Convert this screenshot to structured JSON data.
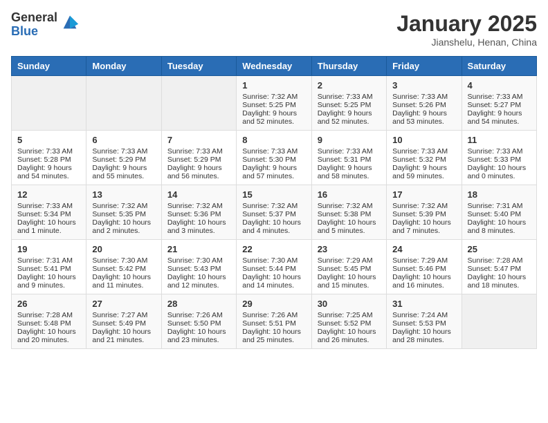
{
  "header": {
    "logo_general": "General",
    "logo_blue": "Blue",
    "month_title": "January 2025",
    "location": "Jianshelu, Henan, China"
  },
  "weekdays": [
    "Sunday",
    "Monday",
    "Tuesday",
    "Wednesday",
    "Thursday",
    "Friday",
    "Saturday"
  ],
  "weeks": [
    [
      {
        "day": "",
        "empty": true
      },
      {
        "day": "",
        "empty": true
      },
      {
        "day": "",
        "empty": true
      },
      {
        "day": "1",
        "sunrise": "Sunrise: 7:32 AM",
        "sunset": "Sunset: 5:25 PM",
        "daylight": "Daylight: 9 hours and 52 minutes."
      },
      {
        "day": "2",
        "sunrise": "Sunrise: 7:33 AM",
        "sunset": "Sunset: 5:25 PM",
        "daylight": "Daylight: 9 hours and 52 minutes."
      },
      {
        "day": "3",
        "sunrise": "Sunrise: 7:33 AM",
        "sunset": "Sunset: 5:26 PM",
        "daylight": "Daylight: 9 hours and 53 minutes."
      },
      {
        "day": "4",
        "sunrise": "Sunrise: 7:33 AM",
        "sunset": "Sunset: 5:27 PM",
        "daylight": "Daylight: 9 hours and 54 minutes."
      }
    ],
    [
      {
        "day": "5",
        "sunrise": "Sunrise: 7:33 AM",
        "sunset": "Sunset: 5:28 PM",
        "daylight": "Daylight: 9 hours and 54 minutes."
      },
      {
        "day": "6",
        "sunrise": "Sunrise: 7:33 AM",
        "sunset": "Sunset: 5:29 PM",
        "daylight": "Daylight: 9 hours and 55 minutes."
      },
      {
        "day": "7",
        "sunrise": "Sunrise: 7:33 AM",
        "sunset": "Sunset: 5:29 PM",
        "daylight": "Daylight: 9 hours and 56 minutes."
      },
      {
        "day": "8",
        "sunrise": "Sunrise: 7:33 AM",
        "sunset": "Sunset: 5:30 PM",
        "daylight": "Daylight: 9 hours and 57 minutes."
      },
      {
        "day": "9",
        "sunrise": "Sunrise: 7:33 AM",
        "sunset": "Sunset: 5:31 PM",
        "daylight": "Daylight: 9 hours and 58 minutes."
      },
      {
        "day": "10",
        "sunrise": "Sunrise: 7:33 AM",
        "sunset": "Sunset: 5:32 PM",
        "daylight": "Daylight: 9 hours and 59 minutes."
      },
      {
        "day": "11",
        "sunrise": "Sunrise: 7:33 AM",
        "sunset": "Sunset: 5:33 PM",
        "daylight": "Daylight: 10 hours and 0 minutes."
      }
    ],
    [
      {
        "day": "12",
        "sunrise": "Sunrise: 7:33 AM",
        "sunset": "Sunset: 5:34 PM",
        "daylight": "Daylight: 10 hours and 1 minute."
      },
      {
        "day": "13",
        "sunrise": "Sunrise: 7:32 AM",
        "sunset": "Sunset: 5:35 PM",
        "daylight": "Daylight: 10 hours and 2 minutes."
      },
      {
        "day": "14",
        "sunrise": "Sunrise: 7:32 AM",
        "sunset": "Sunset: 5:36 PM",
        "daylight": "Daylight: 10 hours and 3 minutes."
      },
      {
        "day": "15",
        "sunrise": "Sunrise: 7:32 AM",
        "sunset": "Sunset: 5:37 PM",
        "daylight": "Daylight: 10 hours and 4 minutes."
      },
      {
        "day": "16",
        "sunrise": "Sunrise: 7:32 AM",
        "sunset": "Sunset: 5:38 PM",
        "daylight": "Daylight: 10 hours and 5 minutes."
      },
      {
        "day": "17",
        "sunrise": "Sunrise: 7:32 AM",
        "sunset": "Sunset: 5:39 PM",
        "daylight": "Daylight: 10 hours and 7 minutes."
      },
      {
        "day": "18",
        "sunrise": "Sunrise: 7:31 AM",
        "sunset": "Sunset: 5:40 PM",
        "daylight": "Daylight: 10 hours and 8 minutes."
      }
    ],
    [
      {
        "day": "19",
        "sunrise": "Sunrise: 7:31 AM",
        "sunset": "Sunset: 5:41 PM",
        "daylight": "Daylight: 10 hours and 9 minutes."
      },
      {
        "day": "20",
        "sunrise": "Sunrise: 7:30 AM",
        "sunset": "Sunset: 5:42 PM",
        "daylight": "Daylight: 10 hours and 11 minutes."
      },
      {
        "day": "21",
        "sunrise": "Sunrise: 7:30 AM",
        "sunset": "Sunset: 5:43 PM",
        "daylight": "Daylight: 10 hours and 12 minutes."
      },
      {
        "day": "22",
        "sunrise": "Sunrise: 7:30 AM",
        "sunset": "Sunset: 5:44 PM",
        "daylight": "Daylight: 10 hours and 14 minutes."
      },
      {
        "day": "23",
        "sunrise": "Sunrise: 7:29 AM",
        "sunset": "Sunset: 5:45 PM",
        "daylight": "Daylight: 10 hours and 15 minutes."
      },
      {
        "day": "24",
        "sunrise": "Sunrise: 7:29 AM",
        "sunset": "Sunset: 5:46 PM",
        "daylight": "Daylight: 10 hours and 16 minutes."
      },
      {
        "day": "25",
        "sunrise": "Sunrise: 7:28 AM",
        "sunset": "Sunset: 5:47 PM",
        "daylight": "Daylight: 10 hours and 18 minutes."
      }
    ],
    [
      {
        "day": "26",
        "sunrise": "Sunrise: 7:28 AM",
        "sunset": "Sunset: 5:48 PM",
        "daylight": "Daylight: 10 hours and 20 minutes."
      },
      {
        "day": "27",
        "sunrise": "Sunrise: 7:27 AM",
        "sunset": "Sunset: 5:49 PM",
        "daylight": "Daylight: 10 hours and 21 minutes."
      },
      {
        "day": "28",
        "sunrise": "Sunrise: 7:26 AM",
        "sunset": "Sunset: 5:50 PM",
        "daylight": "Daylight: 10 hours and 23 minutes."
      },
      {
        "day": "29",
        "sunrise": "Sunrise: 7:26 AM",
        "sunset": "Sunset: 5:51 PM",
        "daylight": "Daylight: 10 hours and 25 minutes."
      },
      {
        "day": "30",
        "sunrise": "Sunrise: 7:25 AM",
        "sunset": "Sunset: 5:52 PM",
        "daylight": "Daylight: 10 hours and 26 minutes."
      },
      {
        "day": "31",
        "sunrise": "Sunrise: 7:24 AM",
        "sunset": "Sunset: 5:53 PM",
        "daylight": "Daylight: 10 hours and 28 minutes."
      },
      {
        "day": "",
        "empty": true
      }
    ]
  ]
}
